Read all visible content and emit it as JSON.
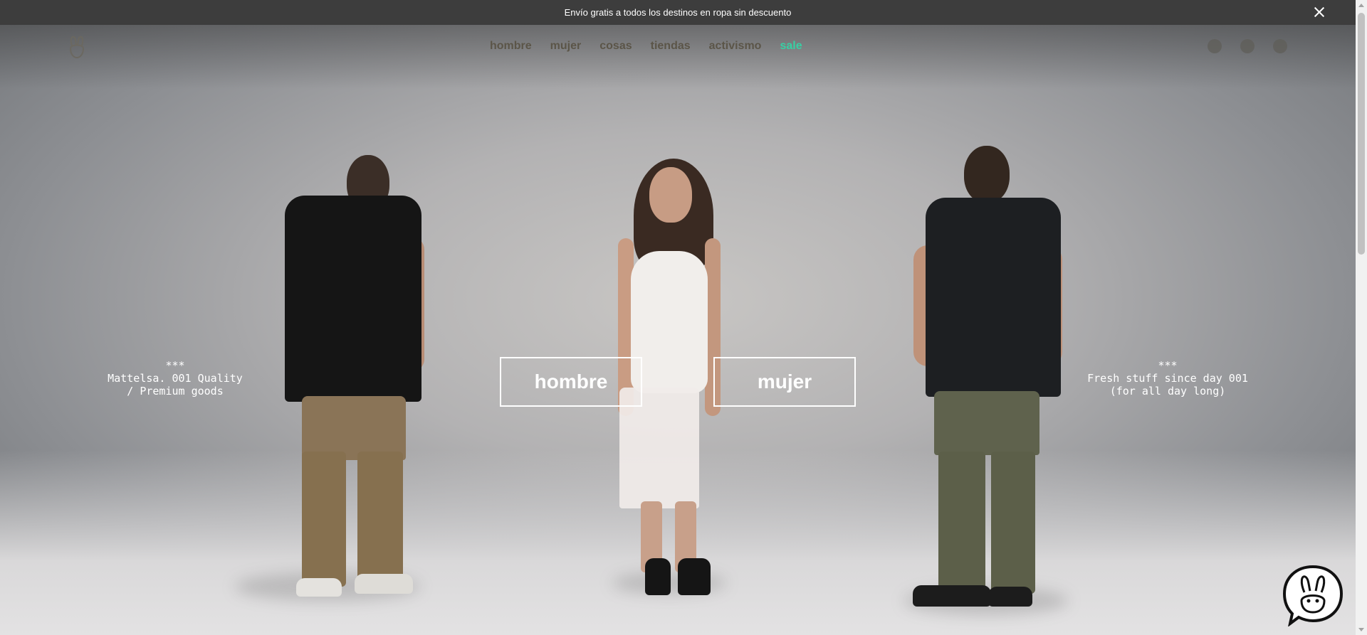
{
  "announcement": {
    "text": "Envío gratis a todos los destinos en ropa sin descuento"
  },
  "header": {
    "nav": [
      "hombre",
      "mujer",
      "cosas",
      "tiendas",
      "activismo",
      "sale"
    ]
  },
  "hero": {
    "left_note": {
      "stars": "***",
      "line1": "Mattelsa. 001 Quality",
      "line2": "/ Premium goods"
    },
    "right_note": {
      "stars": "***",
      "line1": "Fresh stuff since day 001",
      "line2": "(for all day long)"
    },
    "cta_men": "hombre",
    "cta_women": "mujer"
  },
  "colors": {
    "sale": "#37d0a4",
    "announcement_bg": "#3d3d3d"
  },
  "icons": [
    "close-icon",
    "bunny-logo-icon",
    "account-icon",
    "search-icon",
    "cart-icon",
    "chat-bunny-icon"
  ]
}
